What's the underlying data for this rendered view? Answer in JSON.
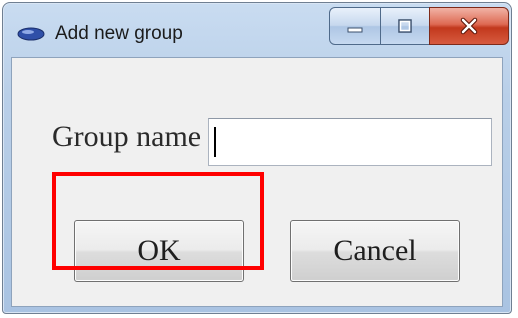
{
  "window": {
    "title": "Add new group",
    "controls": {
      "minimize_icon": "minimize-icon",
      "maximize_icon": "maximize-icon",
      "close_icon": "close-icon"
    }
  },
  "form": {
    "group_name_label": "Group name",
    "group_name_value": ""
  },
  "buttons": {
    "ok_label": "OK",
    "cancel_label": "Cancel"
  },
  "annotation": {
    "highlight_color": "#ff0000",
    "highlight_target": "ok-button"
  }
}
